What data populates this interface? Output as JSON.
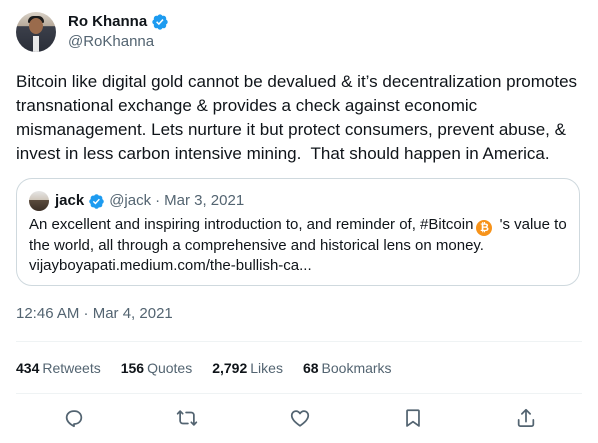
{
  "author": {
    "name": "Ro Khanna",
    "handle": "@RoKhanna",
    "verified": true,
    "verified_color": "#1d9bf0"
  },
  "tweet": {
    "text": "Bitcoin like digital gold cannot be devalued & it’s decentralization promotes transnational exchange & provides a check against economic mismanagement. Lets nurture it but protect consumers, prevent abuse, & invest in less carbon intensive mining.  That should happen in America.",
    "timestamp": "12:46 AM · Mar 4, 2021"
  },
  "quoted_tweet": {
    "name": "jack",
    "handle": "@jack",
    "separator": "·",
    "date": "Mar 3, 2021",
    "text_before_icon": "An excellent and inspiring introduction to, and reminder of, #Bitcoin",
    "icon": "bitcoin-icon",
    "icon_color": "#f7931a",
    "text_after_icon": " 's value to the world, all through a comprehensive and historical lens on money.",
    "link": "vijayboyapati.medium.com/the-bullish-ca..."
  },
  "stats": {
    "retweets_count": "434",
    "retweets_label": "Retweets",
    "quotes_count": "156",
    "quotes_label": "Quotes",
    "likes_count": "2,792",
    "likes_label": "Likes",
    "bookmarks_count": "68",
    "bookmarks_label": "Bookmarks"
  },
  "actions": [
    "reply-icon",
    "retweet-icon",
    "like-icon",
    "bookmark-icon",
    "share-icon"
  ]
}
